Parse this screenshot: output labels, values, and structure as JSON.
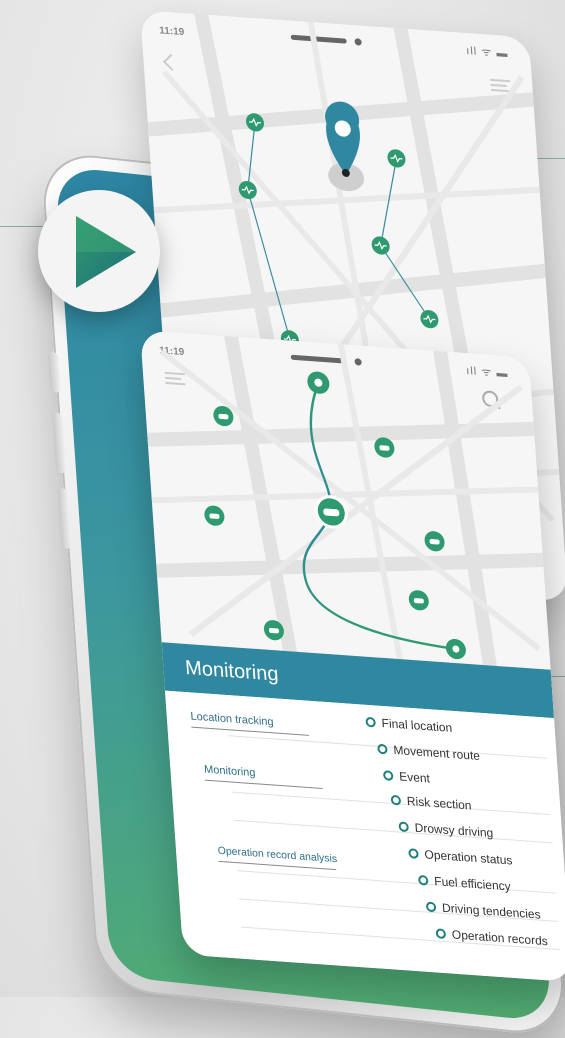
{
  "back_screen": {
    "status": {
      "time": "11:19",
      "icons": "ıll ᯤ ▬"
    }
  },
  "front_screen": {
    "status": {
      "time": "11:19",
      "icons": "ıll ᯤ ▬"
    },
    "panel": {
      "title": "Monitoring",
      "categories": [
        "Location tracking",
        "Monitoring",
        "Operation record analysis"
      ],
      "items": [
        "Final location",
        "Movement route",
        "Event",
        "Risk section",
        "Drowsy driving",
        "Operation status",
        "Fuel efficiency",
        "Driving tendencies",
        "Operation records"
      ]
    }
  },
  "colors": {
    "accent_green": "#2f9a6f",
    "accent_teal": "#2f88a0",
    "map_bg": "#f6f6f6"
  },
  "icons": [
    "play-icon",
    "location-pin-icon",
    "car-icon",
    "pulse-icon",
    "menu-icon",
    "search-icon",
    "back-arrow-icon"
  ]
}
